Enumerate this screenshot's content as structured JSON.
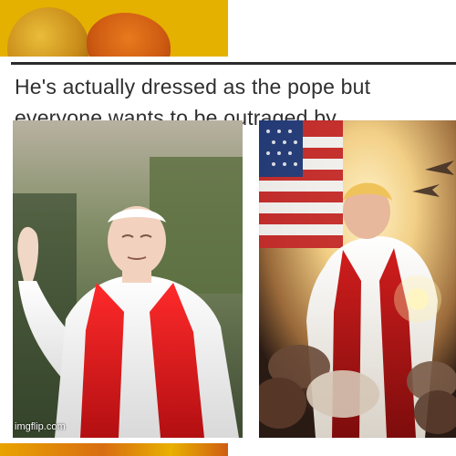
{
  "tweet": {
    "text": "He's actually dressed as the pope but everyone wants to be outraged by nothingness."
  },
  "images": {
    "left_photo": "pope-in-white-cassock-red-stole",
    "right_photo": "painting-man-in-white-robe-red-sash-flag-jets-kneeling-people"
  },
  "watermark": "imgflip.com",
  "colors": {
    "strip_yellow": "#e5b100",
    "strip_orange": "#d86d12",
    "text": "#2f2f2f"
  }
}
